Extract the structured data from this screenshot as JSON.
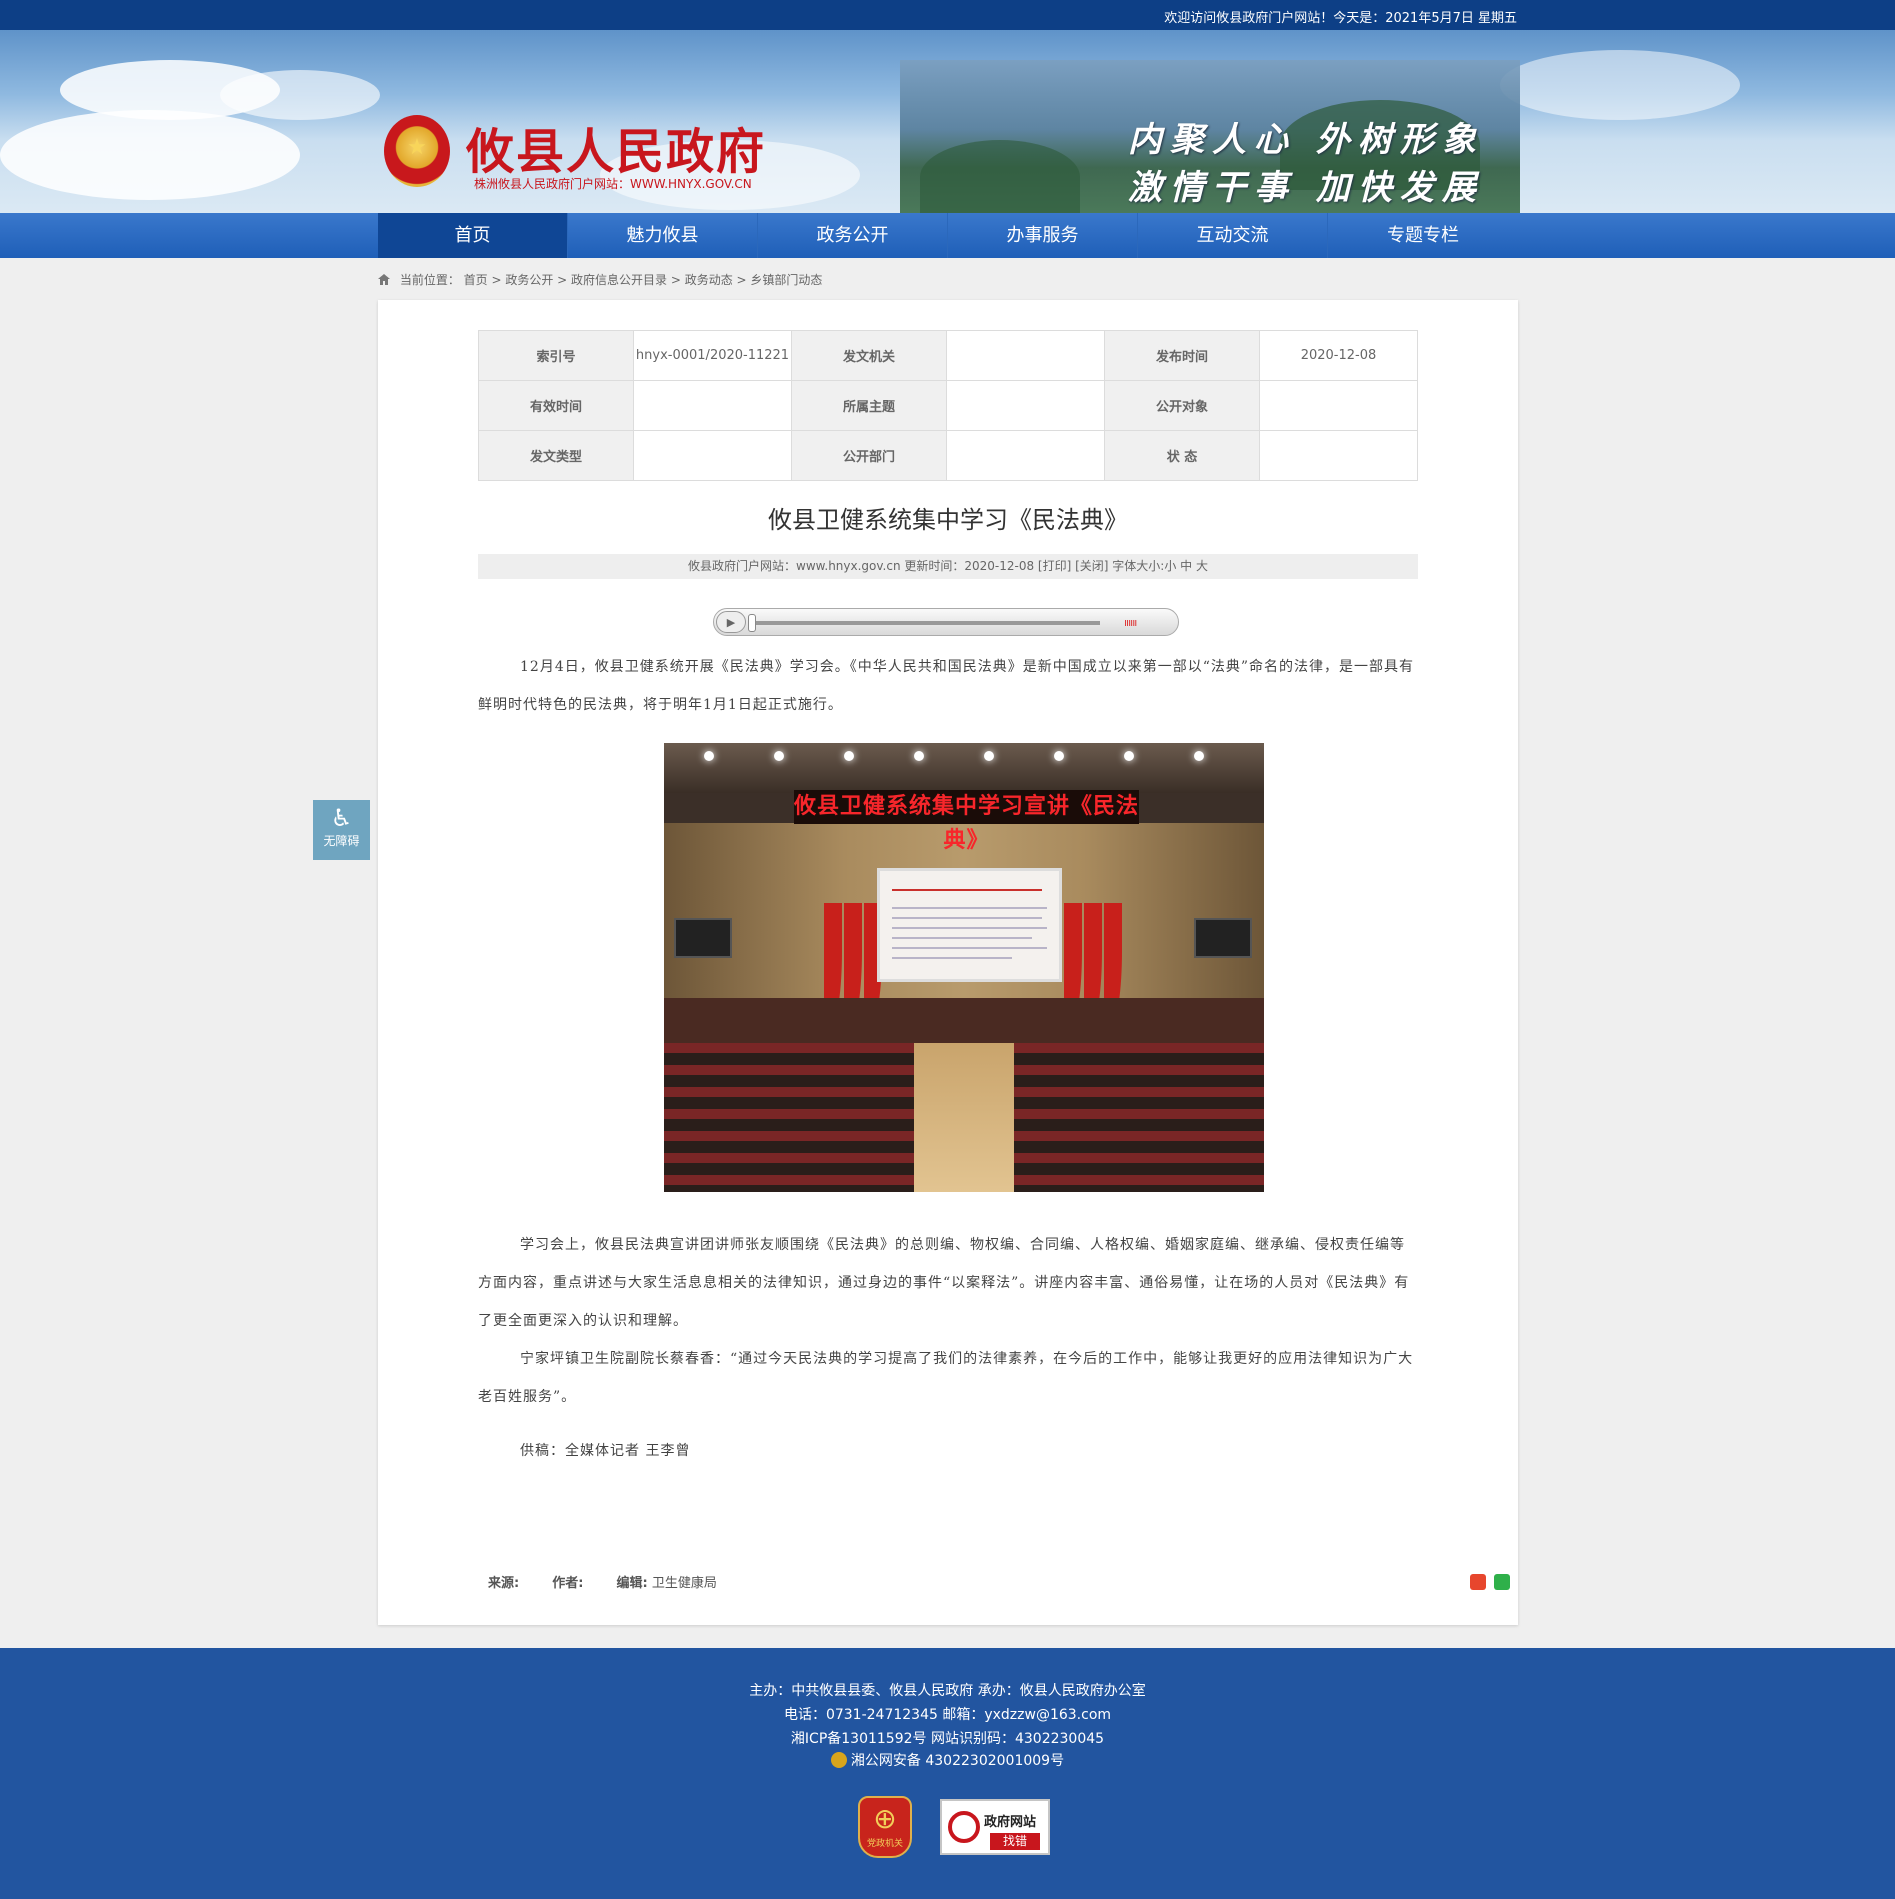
{
  "topbar": {
    "welcome": "欢迎访问攸县政府门户网站！今天是：2021年5月7日 星期五"
  },
  "header": {
    "site_name": "攸县人民政府",
    "site_sub": "株洲攸县人民政府门户网站：WWW.HNYX.GOV.CN",
    "slogan_line1": "内聚人心 外树形象",
    "slogan_line2": "激情干事 加快发展"
  },
  "nav": {
    "items": [
      "首页",
      "魅力攸县",
      "政务公开",
      "办事服务",
      "互动交流",
      "专题专栏"
    ]
  },
  "breadcrumb": {
    "label": "当前位置：",
    "path": "首页 > 政务公开 > 政府信息公开目录 > 政务动态 > 乡镇部门动态"
  },
  "meta_table": {
    "rows": [
      [
        {
          "k": "索引号",
          "v": "hnyx-0001/2020-11221"
        },
        {
          "k": "发文机关",
          "v": ""
        },
        {
          "k": "发布时间",
          "v": "2020-12-08"
        }
      ],
      [
        {
          "k": "有效时间",
          "v": ""
        },
        {
          "k": "所属主题",
          "v": ""
        },
        {
          "k": "公开对象",
          "v": ""
        }
      ],
      [
        {
          "k": "发文类型",
          "v": ""
        },
        {
          "k": "公开部门",
          "v": ""
        },
        {
          "k": "状 态",
          "v": ""
        }
      ]
    ]
  },
  "article": {
    "title": "攸县卫健系统集中学习《民法典》",
    "infobar": "攸县政府门户网站：www.hnyx.gov.cn   更新时间：2020-12-08  [打印] [关闭]  字体大小:小 中 大",
    "para1": "12月4日，攸县卫健系统开展《民法典》学习会。《中华人民共和国民法典》是新中国成立以来第一部以“法典”命名的法律，是一部具有鲜明时代特色的民法典，将于明年1月1日起正式施行。",
    "photo_banner": "攸县卫健系统集中学习宣讲《民法典》",
    "para2": "学习会上，攸县民法典宣讲团讲师张友顺围绕《民法典》的总则编、物权编、合同编、人格权编、婚姻家庭编、继承编、侵权责任编等方面内容，重点讲述与大家生活息息相关的法律知识，通过身边的事件“以案释法”。讲座内容丰富、通俗易懂，让在场的人员对《民法典》有了更全面更深入的认识和理解。",
    "para3": "宁家坪镇卫生院副院长蔡春香：“通过今天民法典的学习提高了我们的法律素养，在今后的工作中，能够让我更好的应用法律知识为广大老百姓服务”。",
    "para4": "供稿：全媒体记者   王李曾",
    "source_label": "来源:",
    "author_label": "作者:",
    "editor_label": "编辑:",
    "editor_value": "卫生健康局"
  },
  "player": {
    "play_icon": "▶",
    "volume": "ıııııı"
  },
  "a11y": {
    "label": "无障碍",
    "icon": "♿"
  },
  "footer": {
    "line1": "主办：中共攸县县委、攸县人民政府 承办：攸县人民政府办公室",
    "line2": "电话：0731-24712345 邮箱：yxdzzw@163.com",
    "line3": "湘ICP备13011592号   网站识别码：4302230045",
    "line4": "湘公网安备 43022302001009号",
    "badge1_text": "党政机关",
    "badge2_line1": "政府网站",
    "badge2_line2": "找错"
  },
  "colors": {
    "nav": "#2563bd",
    "nav_active": "#0f4695",
    "footer": "#2255a0",
    "brand_red": "#c8161d"
  }
}
